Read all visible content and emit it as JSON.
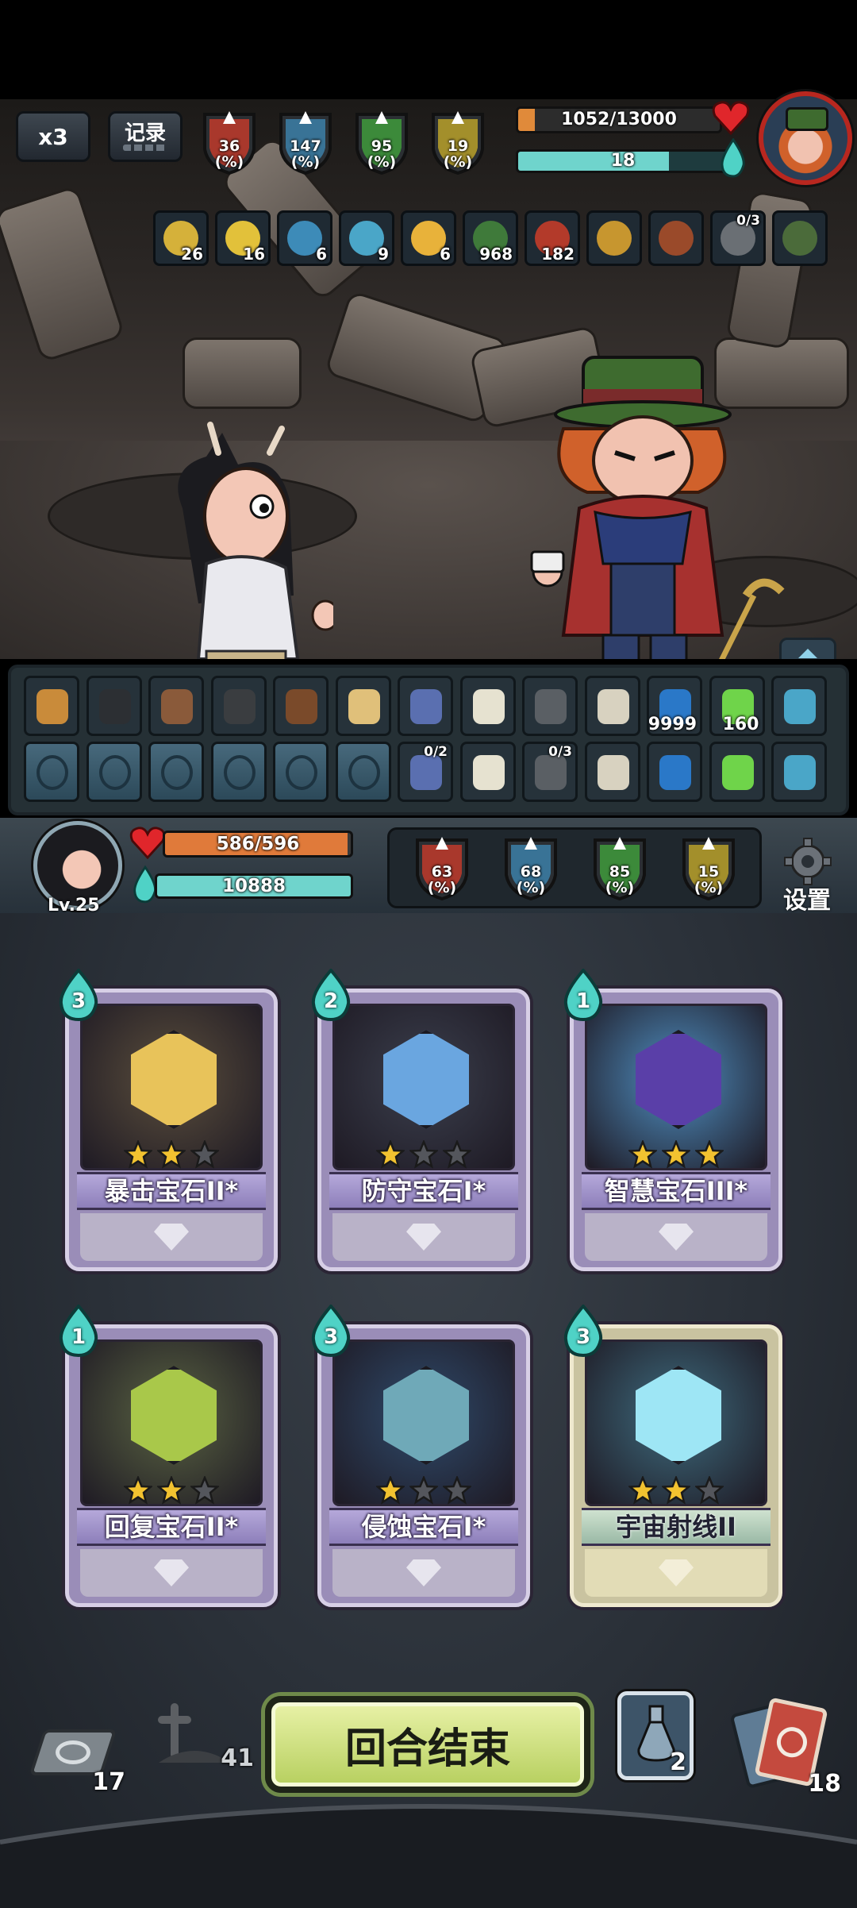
{
  "top_hud": {
    "speed_label": "x3",
    "record_label": "记录",
    "enemy_stats": [
      {
        "value": "36",
        "unit": "(%)",
        "color": "#c0392b",
        "icon": "attack-down-icon"
      },
      {
        "value": "147",
        "unit": "(%)",
        "color": "#3c7fa8",
        "icon": "question-icon"
      },
      {
        "value": "95",
        "unit": "(%)",
        "color": "#3f9a3c",
        "icon": "defense-up-icon"
      },
      {
        "value": "19",
        "unit": "(%)",
        "color": "#b9a02a",
        "icon": "arrow-up-icon"
      }
    ],
    "enemy_hp": "1052/13000",
    "enemy_hp_fraction": 0.081,
    "enemy_mana": "18",
    "enemy_mana_fraction": 0.72,
    "enemy_buffs": [
      {
        "icon": "lightning-rune-icon",
        "count": "26"
      },
      {
        "icon": "lightning-icon",
        "count": "16"
      },
      {
        "icon": "target-icon",
        "count": "6"
      },
      {
        "icon": "wind-icon",
        "count": "9"
      },
      {
        "icon": "candle-icon",
        "count": "6"
      },
      {
        "icon": "skull-icon",
        "count": "968"
      },
      {
        "icon": "claw-icon",
        "count": "182"
      },
      {
        "icon": "flute-icon",
        "count": ""
      },
      {
        "icon": "hat-icon",
        "count": ""
      },
      {
        "icon": "pickaxe-icon",
        "count": "0/3"
      },
      {
        "icon": "book-icon",
        "count": ""
      }
    ]
  },
  "items": {
    "row1": [
      {
        "icon": "hourglass-icon",
        "count": ""
      },
      {
        "icon": "pot-icon",
        "count": ""
      },
      {
        "icon": "glove-icon",
        "count": ""
      },
      {
        "icon": "dagger-icon",
        "count": ""
      },
      {
        "icon": "bag-icon",
        "count": ""
      },
      {
        "icon": "potion-icon",
        "count": ""
      },
      {
        "icon": "disc-icon",
        "count": ""
      },
      {
        "icon": "ice-cream-icon",
        "count": ""
      },
      {
        "icon": "mask-icon",
        "count": ""
      },
      {
        "icon": "scroll-icon",
        "count": ""
      },
      {
        "icon": "shield-gem-icon",
        "count": "9999"
      },
      {
        "icon": "laser-icon",
        "count": "160"
      },
      {
        "icon": "vortex-icon",
        "count": ""
      }
    ],
    "row2": [
      {
        "icon": "snake-rune-icon",
        "count": ""
      },
      {
        "icon": "crack-rune-icon",
        "count": ""
      },
      {
        "icon": "swirl-rune-icon",
        "count": ""
      },
      {
        "icon": "skull-rune-icon",
        "count": ""
      },
      {
        "icon": "runner-rune-icon",
        "count": ""
      },
      {
        "icon": "muscle-rune-icon",
        "count": ""
      },
      {
        "icon": "minion-icon",
        "count": "0/2"
      },
      {
        "icon": "meat-icon",
        "count": ""
      },
      {
        "icon": "goblin-icon",
        "count": "0/3"
      },
      {
        "icon": "helmet-icon",
        "count": ""
      },
      {
        "icon": "leaf-icon",
        "count": ""
      },
      {
        "icon": "hammer-icon",
        "count": ""
      },
      {
        "icon": "stick-icon",
        "count": ""
      }
    ]
  },
  "player": {
    "level": "Lv.25",
    "hp": "586/596",
    "hp_fraction": 0.983,
    "mana": "10888",
    "mana_fraction": 1.0,
    "stats": [
      {
        "value": "63",
        "unit": "(%)",
        "color": "#c0392b",
        "icon": "attack-down-icon"
      },
      {
        "value": "68",
        "unit": "(%)",
        "color": "#3c7fa8",
        "icon": "question-icon"
      },
      {
        "value": "85",
        "unit": "(%)",
        "color": "#3f9a3c",
        "icon": "defense-up-icon"
      },
      {
        "value": "15",
        "unit": "(%)",
        "color": "#b9a02a",
        "icon": "arrow-up-icon"
      }
    ],
    "settings_label": "设置"
  },
  "cards": [
    {
      "name": "暴击宝石II*",
      "cost": "3",
      "stars": 2,
      "max_stars": 3,
      "art": "crit-gem-icon",
      "gem_color": "#e8c35a",
      "bg": "#5b4e3c"
    },
    {
      "name": "防守宝石I*",
      "cost": "2",
      "stars": 1,
      "max_stars": 3,
      "art": "defense-gem-icon",
      "gem_color": "#6aa6e0",
      "bg": "#3b3f4d"
    },
    {
      "name": "智慧宝石III*",
      "cost": "1",
      "stars": 3,
      "max_stars": 3,
      "art": "wisdom-gem-icon",
      "gem_color": "#5a3fa8",
      "bg": "#4f8fc2"
    },
    {
      "name": "回复宝石II*",
      "cost": "1",
      "stars": 2,
      "max_stars": 3,
      "art": "recovery-gem-icon",
      "gem_color": "#a9c84a",
      "bg": "#5a6342"
    },
    {
      "name": "侵蚀宝石I*",
      "cost": "3",
      "stars": 1,
      "max_stars": 3,
      "art": "erosion-gem-icon",
      "gem_color": "#6fa9b8",
      "bg": "#2f4a6b"
    },
    {
      "name": "宇宙射线II",
      "cost": "3",
      "stars": 2,
      "max_stars": 3,
      "art": "cosmic-ray-icon",
      "gem_color": "#9ee6f5",
      "bg": "#3e6b7e",
      "special": true
    }
  ],
  "bottom": {
    "draw_pile": "17",
    "graveyard": "41",
    "end_turn_label": "回合结束",
    "potion_count": "2",
    "discard_pile": "18"
  }
}
